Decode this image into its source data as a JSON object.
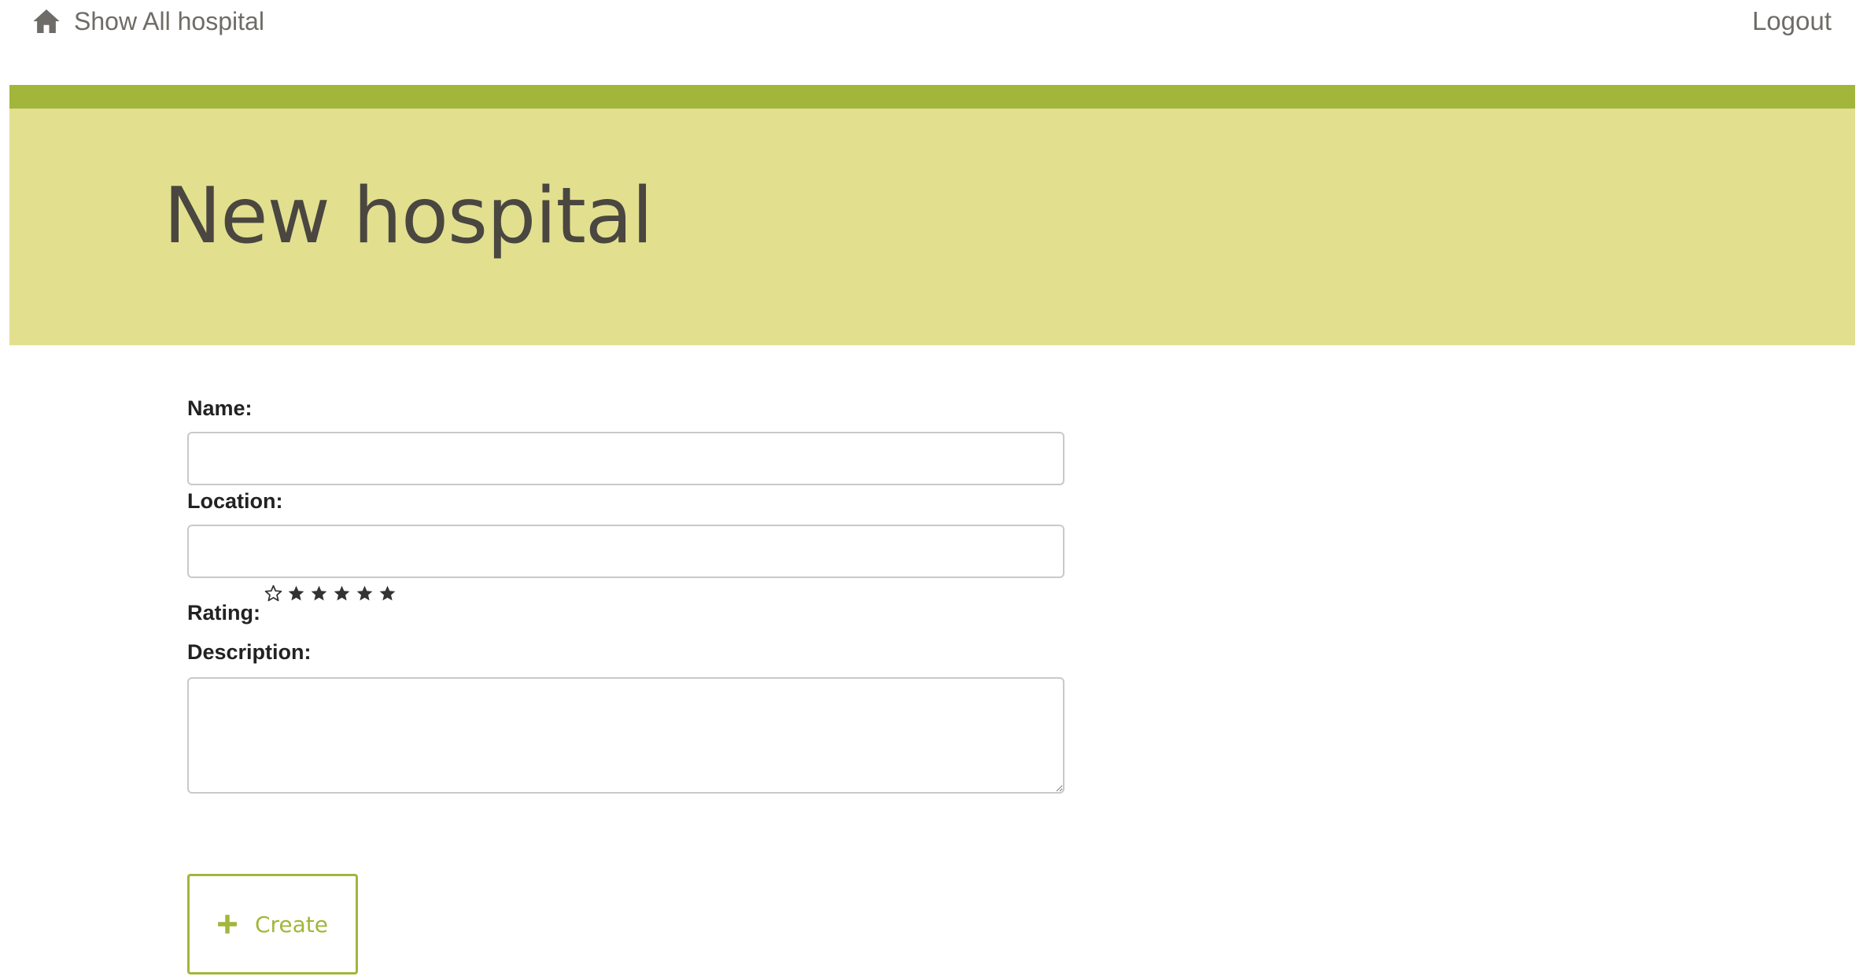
{
  "nav": {
    "home_label": "Show All hospital",
    "home_icon": "home-icon",
    "logout_label": "Logout"
  },
  "header": {
    "title": "New hospital",
    "accent_color": "#a2b63b",
    "band_color": "#e2e08f"
  },
  "form": {
    "name": {
      "label": "Name:",
      "value": "",
      "placeholder": ""
    },
    "location": {
      "label": "Location:",
      "value": "",
      "placeholder": ""
    },
    "rating": {
      "label": "Rating:",
      "icons": [
        "star-outline-icon",
        "star-icon",
        "star-icon",
        "star-icon",
        "star-icon",
        "star-icon"
      ]
    },
    "description": {
      "label": "Description:",
      "value": "",
      "placeholder": ""
    }
  },
  "actions": {
    "create_label": "Create",
    "create_icon": "plus-icon"
  }
}
